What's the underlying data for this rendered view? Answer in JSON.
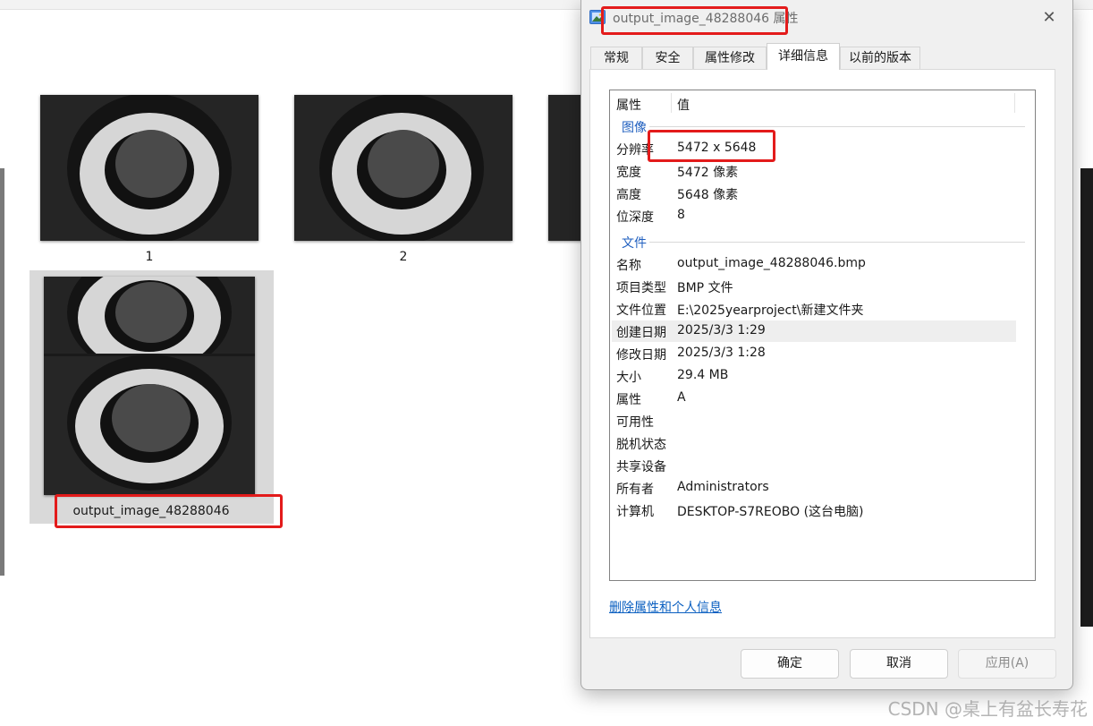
{
  "explorer": {
    "thumbnails": [
      {
        "label": "1"
      },
      {
        "label": "2"
      },
      {
        "label": ""
      }
    ],
    "selected_file": {
      "label": "output_image_48288046"
    }
  },
  "dialog": {
    "title": "output_image_48288046 属性",
    "close_glyph": "✕",
    "tabs": [
      {
        "label": "常规",
        "active": false
      },
      {
        "label": "安全",
        "active": false
      },
      {
        "label": "属性修改",
        "active": false
      },
      {
        "label": "详细信息",
        "active": true
      },
      {
        "label": "以前的版本",
        "active": false
      }
    ],
    "list_header": {
      "property": "属性",
      "value": "值"
    },
    "groups": {
      "image": {
        "title": "图像",
        "rows": [
          {
            "key": "分辨率",
            "value": "5472 x 5648"
          },
          {
            "key": "宽度",
            "value": "5472 像素"
          },
          {
            "key": "高度",
            "value": "5648 像素"
          },
          {
            "key": "位深度",
            "value": "8"
          }
        ]
      },
      "file": {
        "title": "文件",
        "rows": [
          {
            "key": "名称",
            "value": "output_image_48288046.bmp"
          },
          {
            "key": "项目类型",
            "value": "BMP 文件"
          },
          {
            "key": "文件位置",
            "value": "E:\\2025yearproject\\新建文件夹"
          },
          {
            "key": "创建日期",
            "value": "2025/3/3 1:29"
          },
          {
            "key": "修改日期",
            "value": "2025/3/3 1:28"
          },
          {
            "key": "大小",
            "value": "29.4 MB"
          },
          {
            "key": "属性",
            "value": "A"
          },
          {
            "key": "可用性",
            "value": ""
          },
          {
            "key": "脱机状态",
            "value": ""
          },
          {
            "key": "共享设备",
            "value": ""
          },
          {
            "key": "所有者",
            "value": "Administrators"
          },
          {
            "key": "计算机",
            "value": "DESKTOP-S7REOBO (这台电脑)"
          }
        ]
      }
    },
    "remove_link": "删除属性和个人信息",
    "buttons": {
      "ok": "确定",
      "cancel": "取消",
      "apply": "应用(A)"
    }
  },
  "watermark": "CSDN @桌上有盆长寿花",
  "colors": {
    "highlight_red": "#e31b1b",
    "link_blue": "#0a5fc0",
    "group_blue": "#1f5fbf"
  }
}
